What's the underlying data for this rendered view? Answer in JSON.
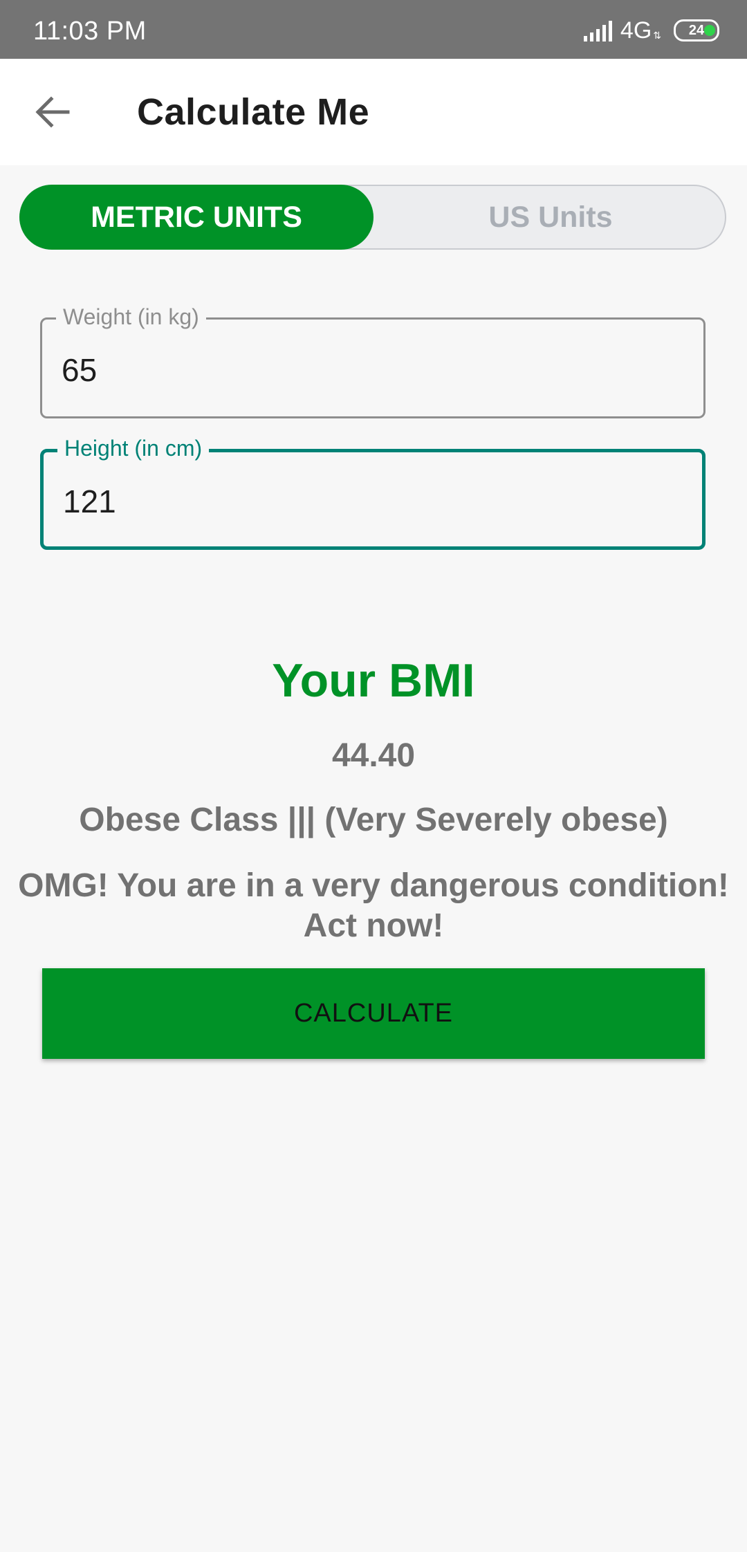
{
  "status_bar": {
    "time": "11:03 PM",
    "network": "4G",
    "battery": "24"
  },
  "app_bar": {
    "title": "Calculate Me",
    "back_icon": "arrow-left-icon"
  },
  "unit_toggle": {
    "metric_label": "METRIC UNITS",
    "us_label": "US Units",
    "selected": "METRIC UNITS"
  },
  "form": {
    "weight": {
      "label": "Weight (in kg)",
      "value": "65"
    },
    "height": {
      "label": "Height (in cm)",
      "value": "121"
    }
  },
  "result": {
    "title": "Your BMI",
    "value": "44.40",
    "classification": "Obese Class ||| (Very Severely obese)",
    "message": "OMG! You are in a very dangerous condition! Act now!"
  },
  "actions": {
    "calculate_label": "CALCULATE"
  },
  "colors": {
    "primary": "#009227",
    "focus": "#008276",
    "text_muted": "#727272",
    "status_bar": "#747474"
  }
}
